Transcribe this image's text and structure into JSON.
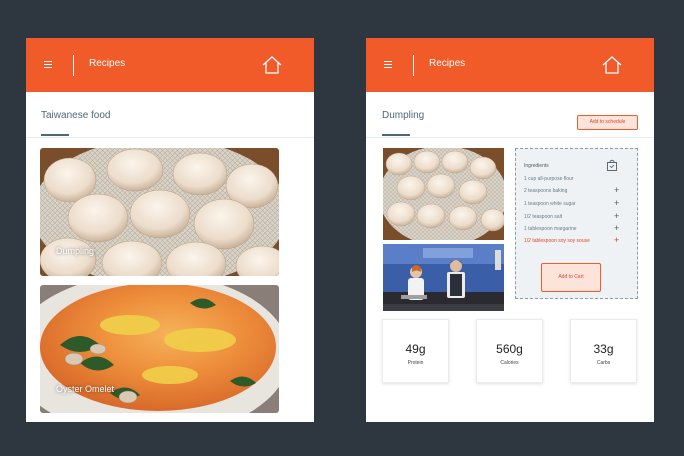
{
  "screens": [
    {
      "app_title": "Recipes",
      "section_title": "Taiwanese food",
      "cards": [
        {
          "label": "Dumpling"
        },
        {
          "label": "Oyster Omelet"
        }
      ]
    },
    {
      "app_title": "Recipes",
      "section_title": "Dumpling",
      "schedule_button": "Add to schedule",
      "ingredients": {
        "title": "Ingredients",
        "items": [
          "1 cup all-purpose flour",
          "2 teaspoons baking",
          "1 teaspoon white sugar",
          "1/2 teaspoon salt",
          "1 tablespoon margarine",
          "1/2 tablespoon soy soy souse"
        ],
        "cart_button": "Add to Cart"
      },
      "stats": [
        {
          "value": "49g",
          "label": "Protein"
        },
        {
          "value": "560g",
          "label": "Calories"
        },
        {
          "value": "33g",
          "label": "Carbs"
        }
      ]
    }
  ],
  "colors": {
    "background": "#2e3740",
    "accent": "#f15a29",
    "title": "#4d6978"
  },
  "icons": [
    "menu-icon",
    "home-icon",
    "shopping-bag-icon",
    "plus-icon"
  ]
}
